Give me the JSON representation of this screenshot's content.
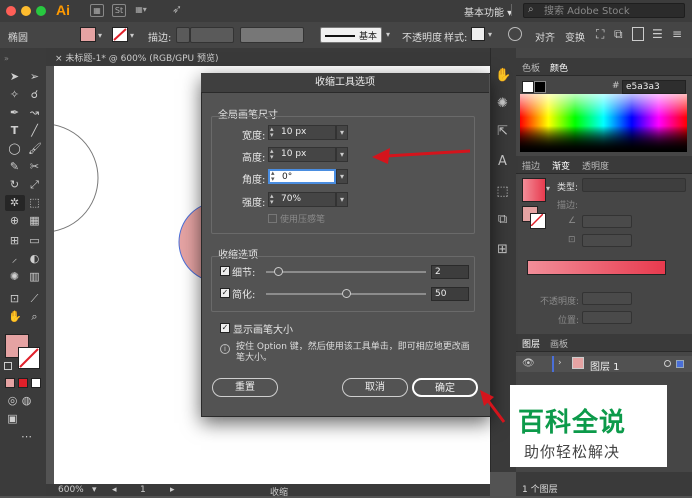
{
  "app": {
    "logo": "Ai",
    "workspace": "基本功能",
    "stock_search_placeholder": "搜索 Adobe Stock",
    "traffic_colors": [
      "#ff5f57",
      "#febc2e",
      "#28c840"
    ]
  },
  "control_bar": {
    "object_label": "椭圆",
    "stroke_label": "描边:",
    "brush_label": "基本",
    "opacity_label": "不透明度",
    "style_label": "样式:",
    "align_label": "对齐",
    "transform_label": "变换"
  },
  "document": {
    "tab_title": "未标题-1* @ 600% (RGB/GPU 预览)",
    "close_glyph": "×",
    "zoom": "600%",
    "page": "1",
    "status_tool": "收缩"
  },
  "dialog": {
    "title": "收缩工具选项",
    "brush_group_label": "全局画笔尺寸",
    "width_label": "宽度:",
    "width_value": "10 px",
    "height_label": "高度:",
    "height_value": "10 px",
    "angle_label": "角度:",
    "angle_value": "0°",
    "intensity_label": "强度:",
    "intensity_value": "70%",
    "pressure_label": "使用压感笔",
    "options_group_label": "收缩选项",
    "detail_label": "细节:",
    "detail_value": "2",
    "detail_fraction": 0.08,
    "simplify_label": "简化:",
    "simplify_value": "50",
    "simplify_fraction": 0.5,
    "show_brush_label": "显示画笔大小",
    "info_text": "按住 Option 键，然后使用该工具单击，即可相应地更改画笔大小。",
    "reset_button": "重置",
    "cancel_button": "取消",
    "ok_button": "确定"
  },
  "right_panel": {
    "color_tabs": [
      "色板",
      "颜色"
    ],
    "hex_prefix": "#",
    "hex_value": "e5a3a3",
    "gradient_tabs": [
      "描边",
      "渐变",
      "透明度"
    ],
    "type_label": "类型:",
    "stroke_label": "描边:",
    "opacity_label": "不透明度:",
    "position_label": "位置:",
    "layers_tabs": [
      "图层",
      "画板"
    ],
    "layer_name": "图层 1",
    "layers_count": "1 个图层"
  },
  "colors": {
    "fill": "#e5a3a3",
    "accent_red": "#e0202a",
    "watermark_green": "#0c9a4a"
  },
  "watermark": {
    "title": "百科全说",
    "subtitle": "助你轻松解决"
  }
}
